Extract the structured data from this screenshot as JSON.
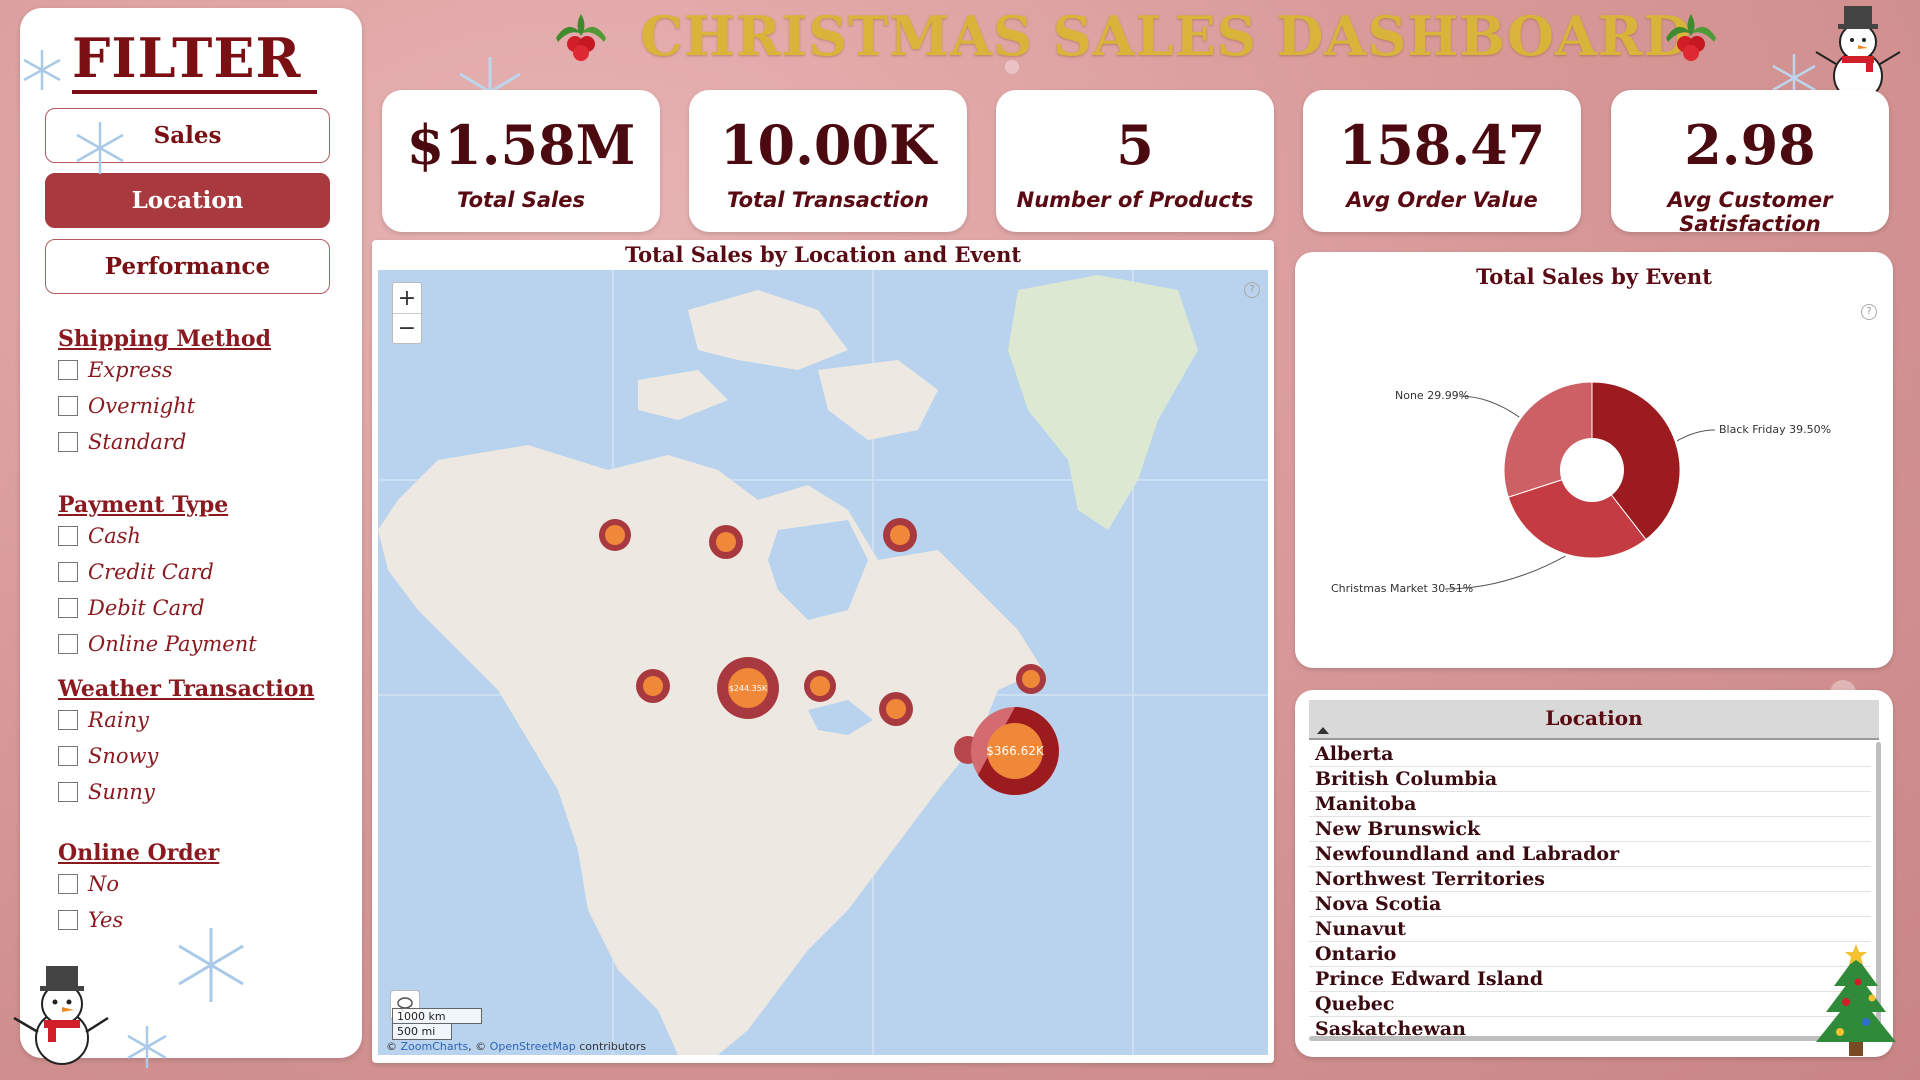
{
  "header": {
    "title": "CHRISTMAS SALES DASHBOARD"
  },
  "filter": {
    "title": "FILTER",
    "nav": [
      {
        "label": "Sales",
        "active": false
      },
      {
        "label": "Location",
        "active": true
      },
      {
        "label": "Performance",
        "active": false
      }
    ],
    "groups": [
      {
        "title": "Shipping Method",
        "options": [
          "Express",
          "Overnight",
          "Standard"
        ]
      },
      {
        "title": "Payment Type",
        "options": [
          "Cash",
          "Credit Card",
          "Debit Card",
          "Online Payment"
        ]
      },
      {
        "title": "Weather Transaction",
        "options": [
          "Rainy",
          "Snowy",
          "Sunny"
        ]
      },
      {
        "title": "Online Order",
        "options": [
          "No",
          "Yes"
        ]
      }
    ]
  },
  "kpis": [
    {
      "value": "$1.58M",
      "label": "Total Sales"
    },
    {
      "value": "10.00K",
      "label": "Total Transaction"
    },
    {
      "value": "5",
      "label": "Number of Products"
    },
    {
      "value": "158.47",
      "label": "Avg Order Value"
    },
    {
      "value": "2.98",
      "label": "Avg Customer Satisfaction"
    }
  ],
  "map": {
    "title": "Total Sales by Location and Event",
    "zoom_in": "+",
    "zoom_out": "−",
    "scale_km": "1000 km",
    "scale_mi": "500 mi",
    "attribution_prefix": "© ",
    "attribution_zoomcharts": "ZoomCharts",
    "attribution_mid": ", © ",
    "attribution_osm": "OpenStreetMap",
    "attribution_suffix": " contributors",
    "bubble_labels": [
      "$244.35K",
      "$366.62K"
    ]
  },
  "donut": {
    "title": "Total Sales by Event",
    "help": "?",
    "colors": {
      "black_friday": "#9b1b1f",
      "christmas_market": "#c53b42",
      "none": "#cc6065"
    }
  },
  "chart_data": {
    "type": "pie",
    "title": "Total Sales by Event",
    "categories": [
      "Black Friday",
      "Christmas Market",
      "None"
    ],
    "values": [
      39.5,
      30.51,
      29.99
    ],
    "labels": [
      "Black Friday 39.50%",
      "Christmas Market 30.51%",
      "None 29.99%"
    ],
    "donut": true
  },
  "location": {
    "header": "Location",
    "items": [
      "Alberta",
      "British Columbia",
      "Manitoba",
      "New Brunswick",
      "Newfoundland and Labrador",
      "Northwest Territories",
      "Nova Scotia",
      "Nunavut",
      "Ontario",
      "Prince Edward Island",
      "Quebec",
      "Saskatchewan"
    ]
  }
}
